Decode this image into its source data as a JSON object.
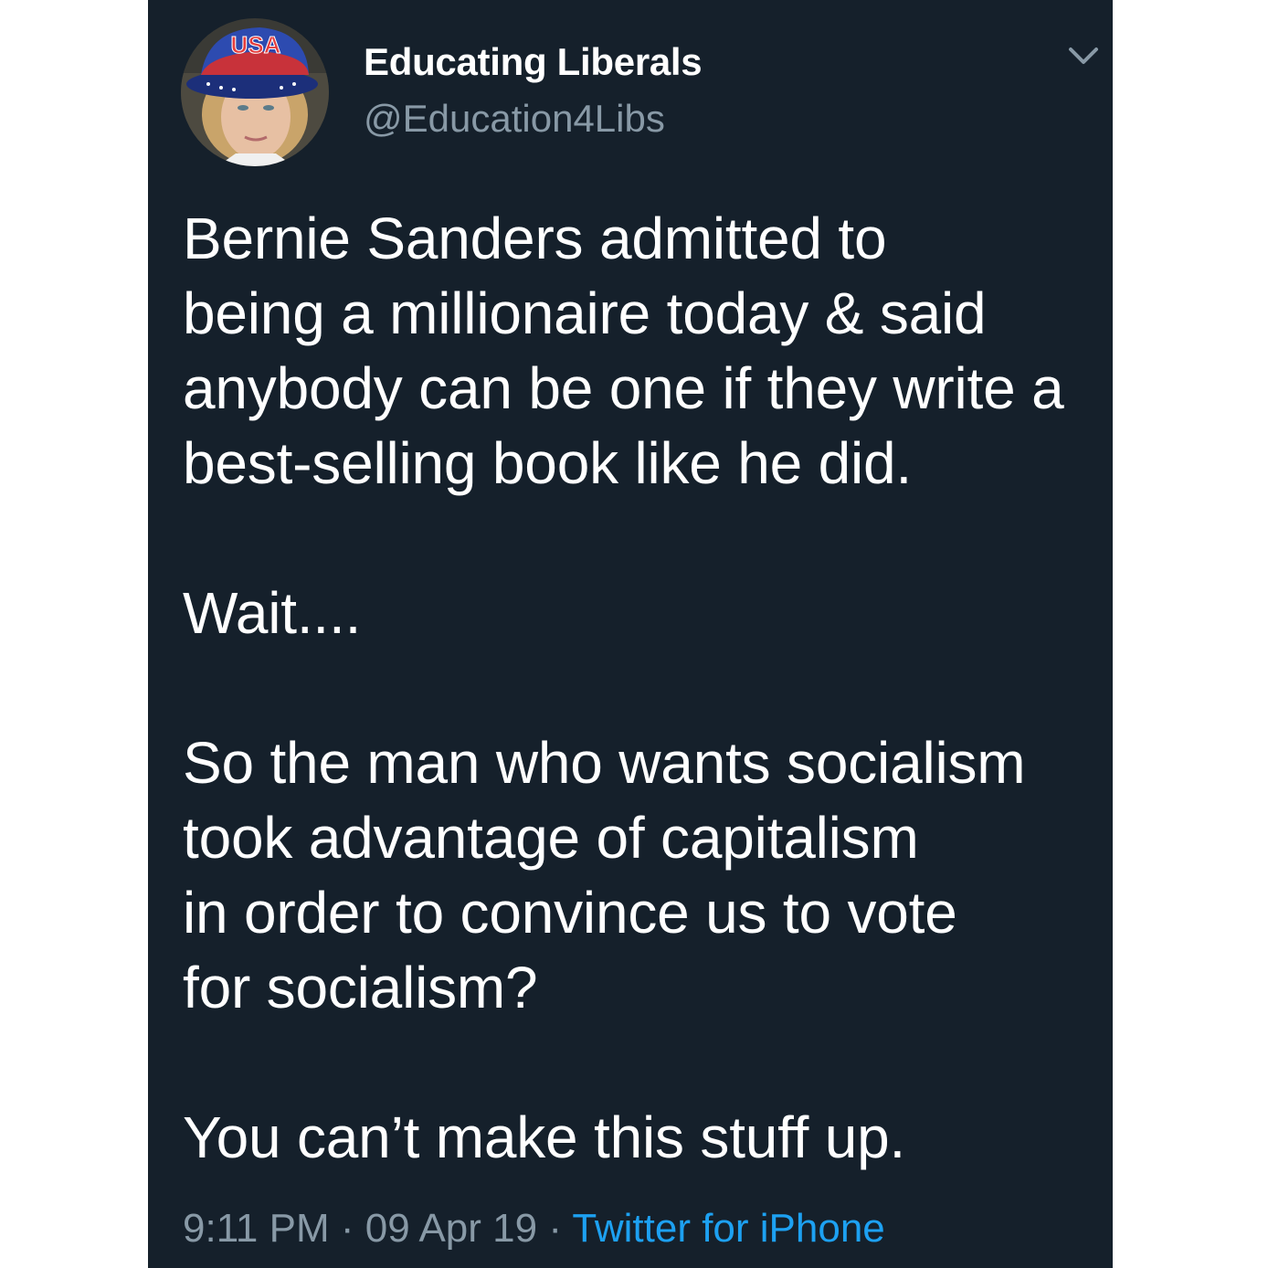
{
  "tweet": {
    "author_name": "Educating Liberals",
    "author_handle": "@Education4Libs",
    "avatar_hat_text": "USA",
    "text": "Bernie Sanders admitted to\nbeing a millionaire today & said\nanybody can be one if they write a\nbest-selling book like he did.\n\nWait....\n\nSo the man who wants socialism\ntook advantage of capitalism\nin order to convince us to vote\nfor socialism?\n\nYou can’t make this stuff up.",
    "time": "9:11 PM",
    "separator": " · ",
    "date": "09 Apr 19",
    "source": "Twitter for iPhone"
  },
  "icons": {
    "menu": "chevron-down-icon",
    "avatar": "profile-photo"
  },
  "colors": {
    "background": "#15202b",
    "text": "#ffffff",
    "secondary_text": "#8899a6",
    "link": "#1da1f2"
  }
}
